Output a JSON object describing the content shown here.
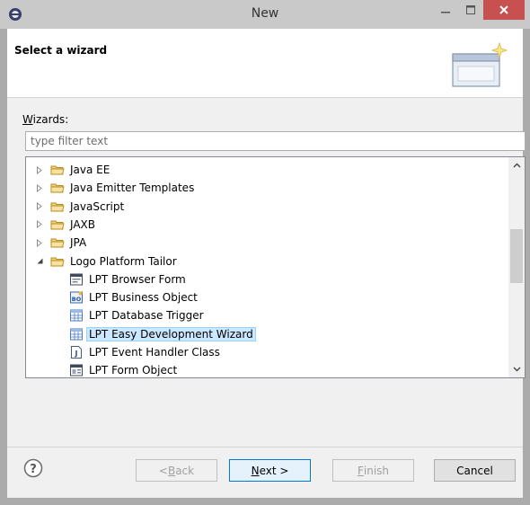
{
  "window": {
    "title": "New",
    "accent_close": "#c75050"
  },
  "header": {
    "title": "Select a wizard"
  },
  "wizards": {
    "label_prefix": "W",
    "label_rest": "izards:",
    "filter_placeholder": "type filter text"
  },
  "tree": {
    "items": [
      {
        "label": "Java EE",
        "type": "folder",
        "expander": "collapsed"
      },
      {
        "label": "Java Emitter Templates",
        "type": "folder",
        "expander": "collapsed"
      },
      {
        "label": "JavaScript",
        "type": "folder",
        "expander": "collapsed"
      },
      {
        "label": "JAXB",
        "type": "folder",
        "expander": "collapsed"
      },
      {
        "label": "JPA",
        "type": "folder",
        "expander": "collapsed"
      },
      {
        "label": "Logo Platform Tailor",
        "type": "folder",
        "expander": "expanded"
      },
      {
        "label": "LPT Browser Form",
        "type": "browser-form-icon",
        "expander": "none"
      },
      {
        "label": "LPT Business Object",
        "type": "business-object-icon",
        "expander": "none"
      },
      {
        "label": "LPT Database Trigger",
        "type": "table-icon",
        "expander": "none"
      },
      {
        "label": "LPT Easy Development Wizard",
        "type": "table-icon",
        "expander": "none",
        "selected": true
      },
      {
        "label": "LPT Event Handler Class",
        "type": "java-class-icon",
        "expander": "none"
      },
      {
        "label": "LPT Form Object",
        "type": "form-object-icon",
        "expander": "none"
      }
    ]
  },
  "buttons": {
    "back_u": "B",
    "back_prefix": "< ",
    "back_rest": "ack",
    "next_u": "N",
    "next_rest": "ext >",
    "finish_u": "F",
    "finish_rest": "inish",
    "cancel": "Cancel"
  },
  "colors": {
    "selection_bg": "#cce8ff",
    "selection_border": "#99d1ff",
    "folder": "#e8c15f"
  }
}
